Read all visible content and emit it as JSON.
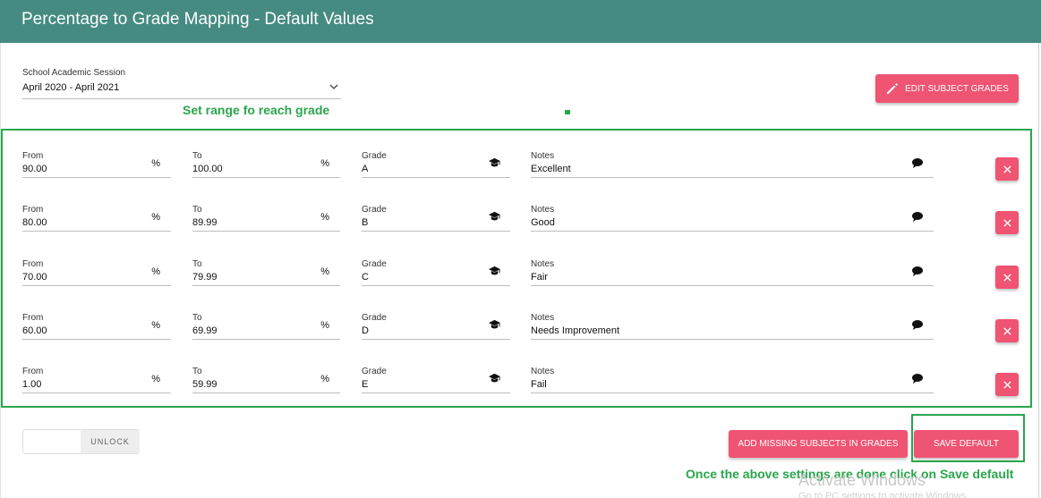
{
  "header": {
    "title": "Percentage to Grade Mapping - Default Values"
  },
  "session": {
    "label": "School Academic Session",
    "value": "April 2020 - April 2021"
  },
  "annotations": {
    "top": "Set range fo reach grade",
    "bottom": "Once the above settings are done click on Save default"
  },
  "buttons": {
    "edit_subject_grades": "EDIT SUBJECT GRADES",
    "add_missing": "ADD MISSING SUBJECTS IN GRADES",
    "save_default": "SAVE DEFAULT"
  },
  "toggle": {
    "label": "UNLOCK"
  },
  "labels": {
    "from": "From",
    "to": "To",
    "grade": "Grade",
    "notes": "Notes",
    "percent": "%"
  },
  "rows": [
    {
      "from": "90.00",
      "to": "100.00",
      "grade": "A",
      "notes": "Excellent"
    },
    {
      "from": "80.00",
      "to": "89.99",
      "grade": "B",
      "notes": "Good"
    },
    {
      "from": "70.00",
      "to": "79.99",
      "grade": "C",
      "notes": "Fair"
    },
    {
      "from": "60.00",
      "to": "69.99",
      "grade": "D",
      "notes": "Needs Improvement"
    },
    {
      "from": "1.00",
      "to": "59.99",
      "grade": "E",
      "notes": "Fail"
    }
  ],
  "watermark": {
    "line1": "Activate Windows",
    "line2": "Go to PC settings to activate Windows."
  },
  "colors": {
    "header": "#458b82",
    "accent": "#ef5472",
    "annotation": "#2aa64b"
  }
}
